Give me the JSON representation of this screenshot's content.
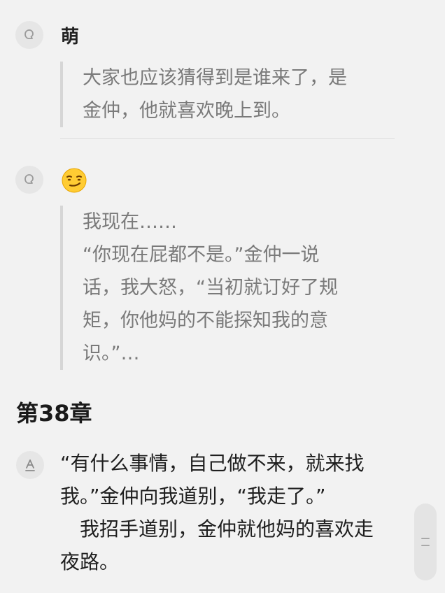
{
  "comments": [
    {
      "username": "萌",
      "icon": "user-avatar-icon",
      "quote_lines": [
        "大家也应该猜得到是谁来了，是",
        "金仲，他就喜欢晚上到。"
      ]
    },
    {
      "username_emoji": "smirk-emoji-icon",
      "icon": "user-avatar-icon",
      "quote_lines": [
        "我现在……",
        "“你现在屁都不是。”金仲一说",
        "话，我大怒，“当初就订好了规",
        "矩，你他妈的不能探知我的意",
        "识。”…"
      ]
    }
  ],
  "chapter": {
    "title": "第38章"
  },
  "paragraph": {
    "icon": "text-a-icon",
    "lines": [
      "“有什么事情，自己做不来，就来找",
      "我。”金仲向我道别，“我走了。”",
      "　我招手道别，金仲就他妈的喜欢走",
      "夜路。"
    ]
  },
  "scroll_handle": {
    "icon": "drag-handle-icon"
  },
  "colors": {
    "background": "#f2f2f2",
    "quote_text": "#7a7a7a",
    "body_text": "#1f1f1f",
    "quote_bar": "#d6d6d6"
  }
}
